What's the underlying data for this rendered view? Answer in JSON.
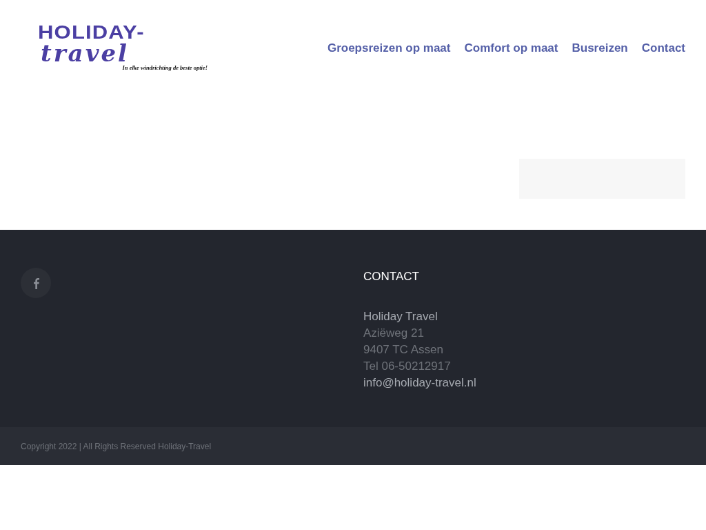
{
  "logo": {
    "title": "HOLIDAY-",
    "script": "travel",
    "tagline": "In elke windrichting de beste optie!"
  },
  "nav": [
    {
      "label": "Groepsreizen op maat"
    },
    {
      "label": "Comfort op maat"
    },
    {
      "label": "Busreizen"
    },
    {
      "label": "Contact"
    }
  ],
  "footer": {
    "contact_heading": "CONTACT",
    "contact_lines": [
      {
        "kind": "name",
        "text": "Holiday Travel"
      },
      {
        "kind": "line",
        "text": "Aziëweg 21"
      },
      {
        "kind": "line",
        "text": "9407 TC Assen"
      },
      {
        "kind": "line",
        "text": "Tel 06-50212917"
      },
      {
        "kind": "link",
        "text": "info@holiday-travel.nl"
      }
    ]
  },
  "copyright": "Copyright 2022 | All Rights Reserved Holiday-Travel"
}
